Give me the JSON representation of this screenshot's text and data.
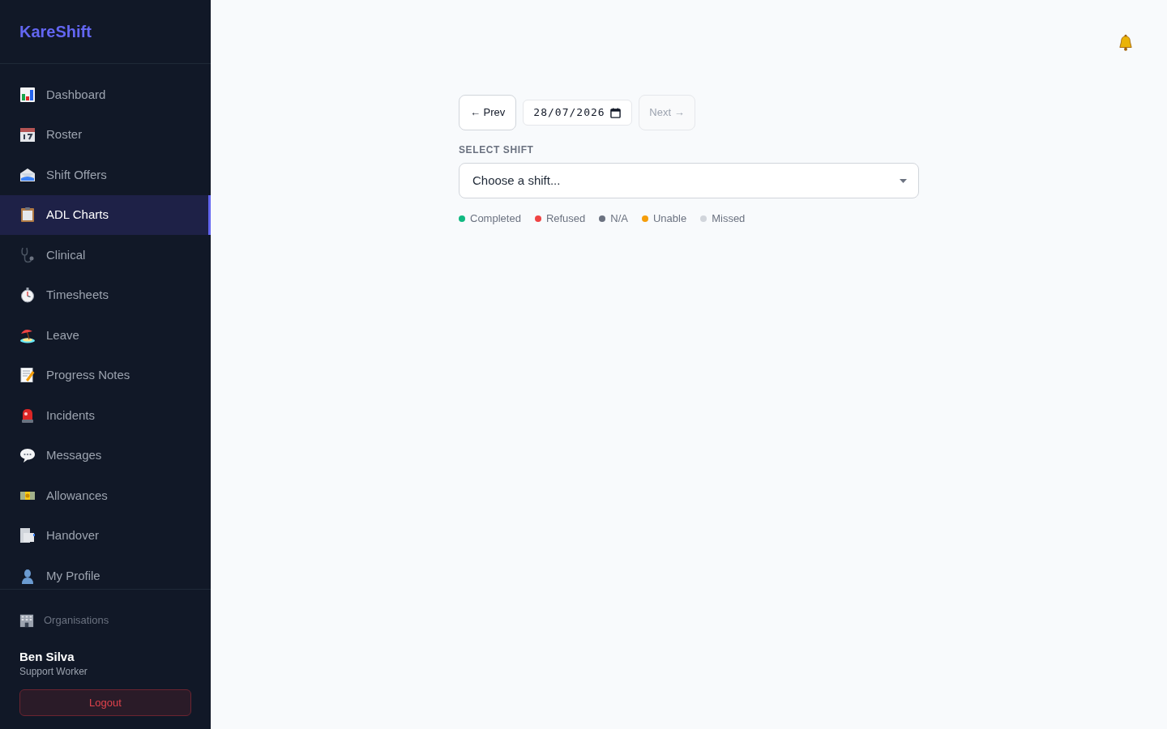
{
  "sidebar": {
    "logo": "KareShift",
    "nav_items": [
      {
        "label": "Dashboard",
        "selected": false
      },
      {
        "label": "Roster",
        "selected": false
      },
      {
        "label": "Shift Offers",
        "selected": false
      },
      {
        "label": "ADL Charts",
        "selected": true
      },
      {
        "label": "Clinical",
        "selected": false
      },
      {
        "label": "Timesheets",
        "selected": false
      },
      {
        "label": "Leave",
        "selected": false
      },
      {
        "label": "Progress Notes",
        "selected": false
      },
      {
        "label": "Incidents",
        "selected": false
      },
      {
        "label": "Messages",
        "selected": false
      },
      {
        "label": "Allowances",
        "selected": false
      },
      {
        "label": "Handover",
        "selected": false
      },
      {
        "label": "My Profile",
        "selected": false
      }
    ],
    "footer": {
      "organisations_link": "Organisations",
      "user_name": "Ben Silva",
      "user_role": "Support Worker",
      "logout_button": "Logout"
    }
  },
  "date_nav": {
    "prev_button": {
      "label": "← Prev",
      "disabled": false
    },
    "date": "28/07/2026",
    "next_button": {
      "label": "Next →",
      "disabled": true
    }
  },
  "shift_select": {
    "label": "SELECT SHIFT",
    "value": "Choose a shift..."
  },
  "legend": [
    {
      "label": "Completed",
      "color": "#10b981"
    },
    {
      "label": "Refused",
      "color": "#ef4444"
    },
    {
      "label": "N/A",
      "color": "#6b7280"
    },
    {
      "label": "Unable",
      "color": "#f59e0b"
    },
    {
      "label": "Missed",
      "color": "#d1d5db"
    }
  ]
}
